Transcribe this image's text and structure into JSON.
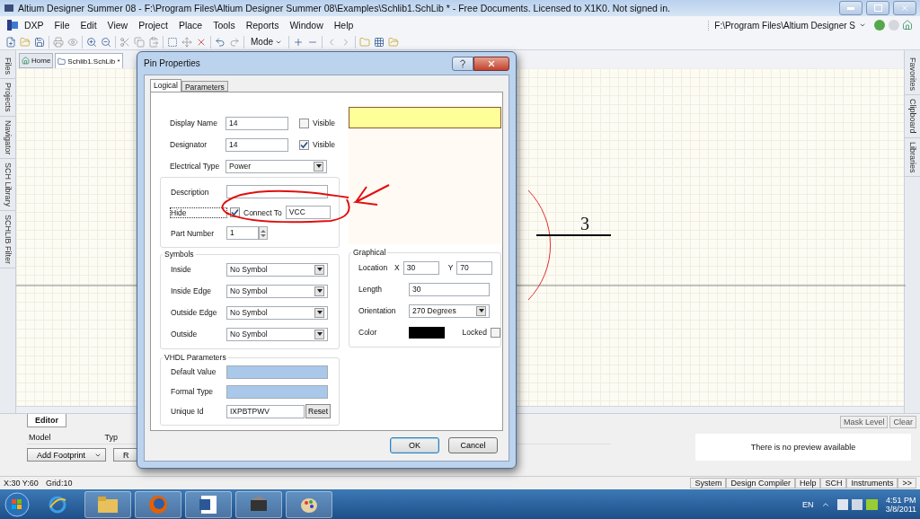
{
  "window": {
    "title": "Altium Designer Summer 08 - F:\\Program Files\\Altium Designer Summer 08\\Examples\\Schlib1.SchLib * - Free Documents. Licensed to X1K0. Not signed in."
  },
  "menu": [
    "DXP",
    "File",
    "Edit",
    "View",
    "Project",
    "Place",
    "Tools",
    "Reports",
    "Window",
    "Help"
  ],
  "path_combo": "F:\\Program Files\\Altium Designer S",
  "toolbar": {
    "mode_label": "Mode"
  },
  "left_panels": [
    "Files",
    "Projects",
    "Navigator",
    "SCH Library",
    "SCHLIB Filter"
  ],
  "right_panels": [
    "Favorites",
    "Clipboard",
    "Libraries"
  ],
  "doc_tabs": [
    {
      "label": "Home",
      "selected": false
    },
    {
      "label": "Schlib1.SchLib *",
      "selected": true
    }
  ],
  "canvas": {
    "pin_label": "3"
  },
  "bottom_panel": {
    "tabs": [
      {
        "label": "Editor",
        "selected": true
      }
    ],
    "columns": [
      "Model",
      "Typ"
    ],
    "buttons": [
      "Add Footprint",
      "R"
    ],
    "mask_level": "Mask Level",
    "clear": "Clear",
    "preview": "There is no preview available"
  },
  "status_bar": {
    "coords": "X:30 Y:60",
    "grid": "Grid:10",
    "buttons": [
      "System",
      "Design Compiler",
      "Help",
      "SCH",
      "Instruments",
      ">>"
    ]
  },
  "taskbar": {
    "language": "EN",
    "time": "4:51 PM",
    "date": "3/8/2011"
  },
  "dialog": {
    "title": "Pin Properties",
    "tabs": [
      {
        "label": "Logical",
        "selected": true
      },
      {
        "label": "Parameters",
        "selected": false
      }
    ],
    "display_name": {
      "label": "Display Name",
      "value": "14",
      "visible_label": "Visible",
      "visible": false
    },
    "designator": {
      "label": "Designator",
      "value": "14",
      "visible_label": "Visible",
      "visible": true
    },
    "electrical_type": {
      "label": "Electrical Type",
      "value": "Power"
    },
    "description": {
      "label": "Description"
    },
    "hide": {
      "label": "Hide",
      "checked": true,
      "connect_label": "Connect To",
      "connect_value": "VCC"
    },
    "part_number": {
      "label": "Part Number",
      "value": "1"
    },
    "symbols": {
      "title": "Symbols",
      "rows": [
        {
          "label": "Inside",
          "value": "No Symbol"
        },
        {
          "label": "Inside Edge",
          "value": "No Symbol"
        },
        {
          "label": "Outside Edge",
          "value": "No Symbol"
        },
        {
          "label": "Outside",
          "value": "No Symbol"
        }
      ]
    },
    "graphical": {
      "title": "Graphical",
      "location_label": "Location",
      "x_label": "X",
      "x_value": "30",
      "y_label": "Y",
      "y_value": "70",
      "length_label": "Length",
      "length_value": "30",
      "orientation_label": "Orientation",
      "orientation_value": "270 Degrees",
      "color_label": "Color",
      "color": "#000000",
      "locked_label": "Locked",
      "locked": false
    },
    "vhdl": {
      "title": "VHDL Parameters",
      "default_label": "Default Value",
      "formal_label": "Formal Type",
      "unique_label": "Unique Id",
      "unique_value": "IXPBTPWV",
      "reset": "Reset"
    },
    "buttons": [
      "OK",
      "Cancel"
    ]
  }
}
